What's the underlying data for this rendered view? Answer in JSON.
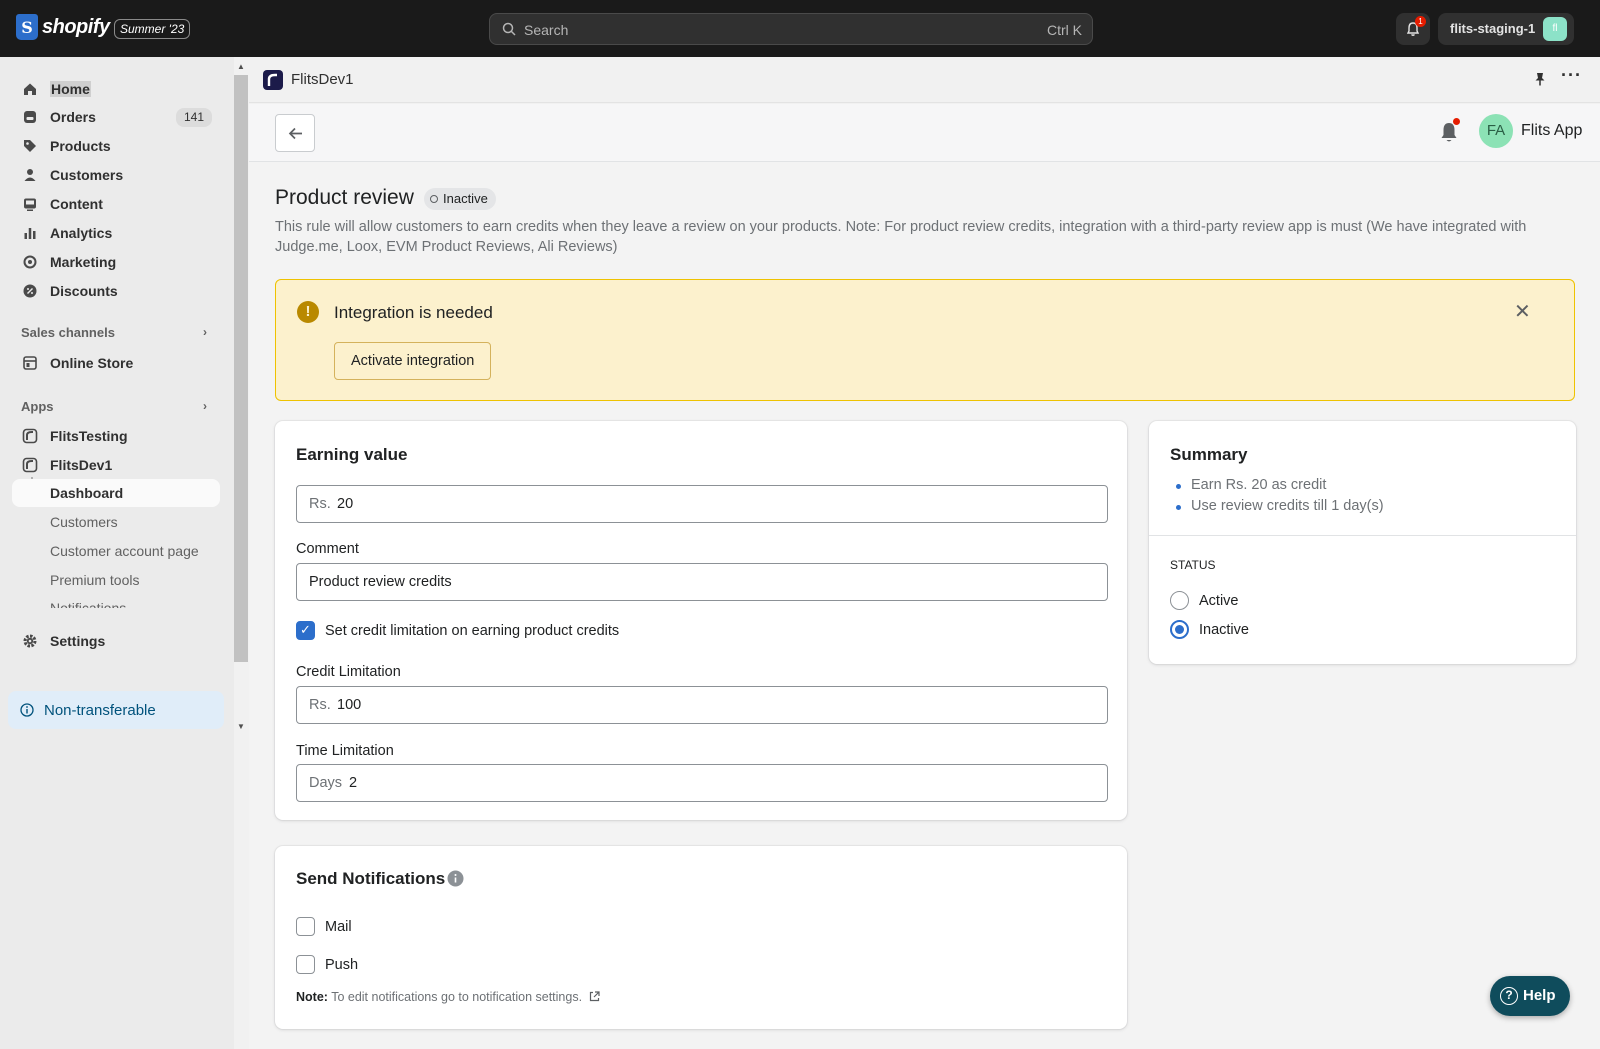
{
  "topbar": {
    "brand": "shopify",
    "edition": "Summer '23",
    "search_placeholder": "Search",
    "search_shortcut": "Ctrl K",
    "notification_count": "1",
    "store_name": "flits-staging-1",
    "store_avatar": "fl"
  },
  "sidebar": {
    "items": [
      {
        "label": "Home",
        "icon": "home-icon"
      },
      {
        "label": "Orders",
        "icon": "orders-icon",
        "count": "141"
      },
      {
        "label": "Products",
        "icon": "tag-icon"
      },
      {
        "label": "Customers",
        "icon": "person-icon"
      },
      {
        "label": "Content",
        "icon": "content-icon"
      },
      {
        "label": "Analytics",
        "icon": "bar-chart-icon"
      },
      {
        "label": "Marketing",
        "icon": "target-icon"
      },
      {
        "label": "Discounts",
        "icon": "discount-icon"
      }
    ],
    "sales_channels_label": "Sales channels",
    "online_store_label": "Online Store",
    "apps_label": "Apps",
    "apps": [
      "FlitsTesting",
      "FlitsDev1"
    ],
    "app_subitems": [
      "Dashboard",
      "Customers",
      "Customer account page",
      "Premium tools",
      "Notifications"
    ],
    "settings_label": "Settings",
    "non_transferable_label": "Non-transferable"
  },
  "appbar": {
    "app_name": "FlitsDev1",
    "more_label": "···"
  },
  "header": {
    "avatar_initials": "FA",
    "app_label": "Flits App"
  },
  "page": {
    "title": "Product review",
    "status_badge": "Inactive",
    "description": "This rule will allow customers to earn credits when they leave a review on your products. Note: For product review credits, integration with a third-party review app is must (We have integrated with Judge.me, Loox, EVM Product Reviews, Ali Reviews)"
  },
  "banner": {
    "title": "Integration is needed",
    "button_label": "Activate integration",
    "close_label": "✕",
    "warn_glyph": "!"
  },
  "earning": {
    "title": "Earning value",
    "value_prefix": "Rs.",
    "value": "20",
    "comment_label": "Comment",
    "comment_value": "Product review credits",
    "limit_checkbox_label": "Set credit limitation on earning product credits",
    "limit_checked": true,
    "credit_limit_label": "Credit Limitation",
    "credit_limit_prefix": "Rs.",
    "credit_limit_value": "100",
    "time_limit_label": "Time Limitation",
    "time_limit_prefix": "Days",
    "time_limit_value": "2"
  },
  "notifications": {
    "title": "Send Notifications",
    "options": [
      {
        "label": "Mail",
        "checked": false
      },
      {
        "label": "Push",
        "checked": false
      }
    ],
    "note_prefix": "Note:",
    "note_text": "To edit notifications go to notification settings."
  },
  "summary": {
    "title": "Summary",
    "items": [
      "Earn Rs. 20 as credit",
      "Use review credits till 1 day(s)"
    ],
    "status_label": "STATUS",
    "status_options": [
      {
        "label": "Active",
        "selected": false
      },
      {
        "label": "Inactive",
        "selected": true
      }
    ]
  },
  "help": {
    "label": "Help",
    "glyph": "?"
  },
  "colors": {
    "topbar_bg": "#1a1a1a",
    "accent_blue": "#2c6ecb",
    "warning_bg": "#fcf1cd",
    "warning_border": "#eec200",
    "help_bg": "#0f4c5c",
    "nontransferable_bg": "#e0edf9"
  }
}
